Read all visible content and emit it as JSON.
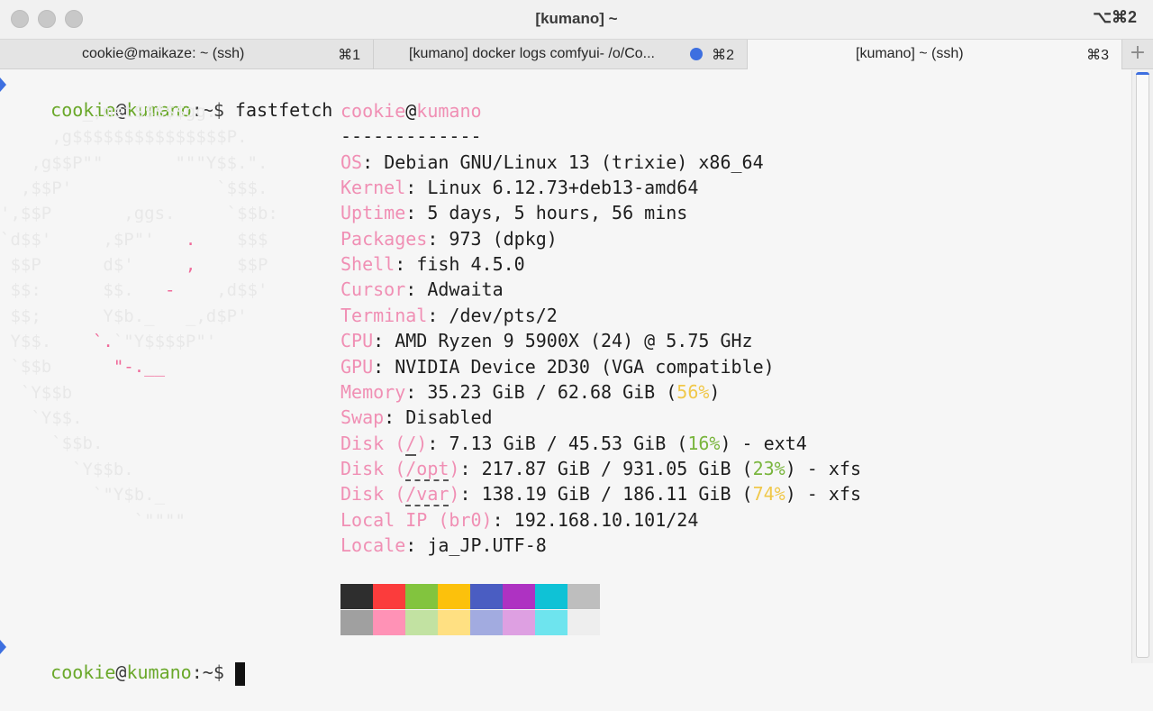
{
  "window": {
    "title": "[kumano] ~",
    "shortcut": "⌥⌘2"
  },
  "tabs": [
    {
      "title": "cookie@maikaze: ~ (ssh)",
      "key": "⌘1",
      "active": false
    },
    {
      "title": "[kumano] docker logs comfyui- /o/Co...",
      "key": "⌘2",
      "active": false,
      "activity": true
    },
    {
      "title": "[kumano] ~ (ssh)",
      "key": "⌘3",
      "active": true
    }
  ],
  "new_tab_label": "+",
  "prompt": {
    "user": "cookie",
    "at": "@",
    "host": "kumano",
    "path": ":~",
    "symbol": "$"
  },
  "command": "fastfetch",
  "logo_lines": [
    [
      "        _,met$$$$$gg.",
      ""
    ],
    [
      "     ,g$$$$$$$$$$$$$$$P.",
      ""
    ],
    [
      "   ,g$$P\"\"       \"\"\"Y$$.\".",
      ""
    ],
    [
      "  ,$$P'              `$$$.",
      ""
    ],
    [
      "',$$P       ,ggs.     `$$b:",
      ""
    ],
    [
      "`d$$'     ,$P\"'   ",
      ".",
      "    $$$"
    ],
    [
      " $$P      d$'     ",
      ",",
      "    $$P"
    ],
    [
      " $$:      $$.   ",
      "-",
      "    ,d$$'"
    ],
    [
      " $$;      Y$b._   _,d$P'",
      ""
    ],
    [
      " Y$$.    ",
      "`.",
      "`\"Y$$$$P\"'"
    ],
    [
      " `$$b      ",
      "\"-.__",
      ""
    ],
    [
      "  `Y$$b",
      ""
    ],
    [
      "   `Y$$.",
      ""
    ],
    [
      "     `$$b.",
      ""
    ],
    [
      "       `Y$$b.",
      ""
    ],
    [
      "         `\"Y$b._",
      ""
    ],
    [
      "             `\"\"\"\"",
      ""
    ]
  ],
  "sysinfo": {
    "user": "cookie",
    "at": "@",
    "host": "kumano",
    "separator": "-------------",
    "rows": [
      {
        "key": "OS",
        "value": "Debian GNU/Linux 13 (trixie) x86_64"
      },
      {
        "key": "Kernel",
        "value": "Linux 6.12.73+deb13-amd64"
      },
      {
        "key": "Uptime",
        "value": "5 days, 5 hours, 56 mins"
      },
      {
        "key": "Packages",
        "value": "973 (dpkg)"
      },
      {
        "key": "Shell",
        "value": "fish 4.5.0"
      },
      {
        "key": "Cursor",
        "value": "Adwaita"
      },
      {
        "key": "Terminal",
        "value": "/dev/pts/2"
      },
      {
        "key": "CPU",
        "value": "AMD Ryzen 9 5900X (24) @ 5.75 GHz"
      },
      {
        "key": "GPU",
        "value": "NVIDIA Device 2D30 (VGA compatible)"
      },
      {
        "key": "Memory",
        "value_pre": "35.23 GiB / 62.68 GiB (",
        "pct": "56%",
        "pct_color": "yellow",
        "value_post": ")"
      },
      {
        "key": "Swap",
        "value": "Disabled"
      },
      {
        "key_pre": "Disk (",
        "key_path": "/",
        "key_post": ")",
        "value_pre": "7.13 GiB / 45.53 GiB (",
        "pct": "16%",
        "pct_color": "green",
        "value_post": ") - ext4"
      },
      {
        "key_pre": "Disk (",
        "key_path": "/opt",
        "key_post": ")",
        "value_pre": "217.87 GiB / 931.05 GiB (",
        "pct": "23%",
        "pct_color": "green",
        "value_post": ") - xfs"
      },
      {
        "key_pre": "Disk (",
        "key_path": "/var",
        "key_post": ")",
        "value_pre": "138.19 GiB / 186.11 GiB (",
        "pct": "74%",
        "pct_color": "yellow",
        "value_post": ") - xfs"
      },
      {
        "key": "Local IP (br0)",
        "value": "192.168.10.101/24"
      },
      {
        "key": "Locale",
        "value": "ja_JP.UTF-8"
      }
    ]
  },
  "palette": {
    "normal": [
      "#2e2e2e",
      "#fb3c3c",
      "#82c43e",
      "#fcc10c",
      "#4a5dc2",
      "#ae32c2",
      "#0fc2d6",
      "#bebebe"
    ],
    "bright": [
      "#a0a0a0",
      "#ff92b6",
      "#c2e2a2",
      "#ffe082",
      "#a2abe0",
      "#dea0e2",
      "#6ee4ee",
      "#eeeeee"
    ]
  },
  "colors": {
    "prompt": "#6aa82a",
    "info_key": "#f08fb4",
    "accent": "#3d6fe0"
  }
}
